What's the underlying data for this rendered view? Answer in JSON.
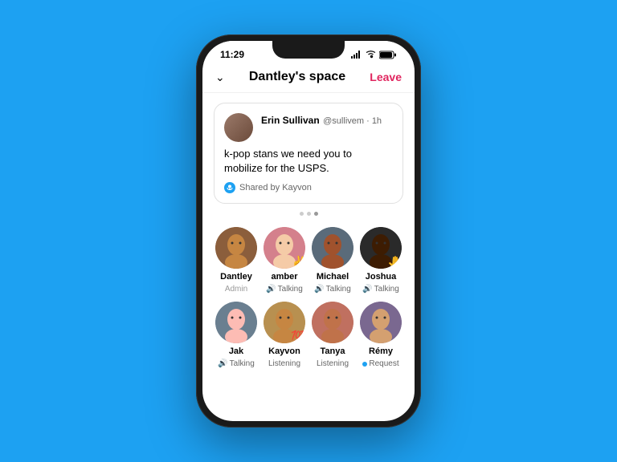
{
  "background": "#1DA1F2",
  "phone": {
    "status_bar": {
      "time": "11:29"
    },
    "header": {
      "title": "Dantley's space",
      "leave_label": "Leave",
      "chevron": "⌄"
    },
    "tweet_card": {
      "author_name": "Erin Sullivan",
      "author_handle": "@sullivem · 1h",
      "tweet_text": "k-pop stans we need you to mobilize for the USPS.",
      "shared_by": "Shared by Kayvon"
    },
    "dots": [
      {
        "active": false
      },
      {
        "active": false
      },
      {
        "active": true
      }
    ],
    "speakers": [
      {
        "name": "Dantley",
        "status": "Admin",
        "status_type": "admin",
        "emoji": "",
        "avatar_class": "av-dantley",
        "face": "👨🏽"
      },
      {
        "name": "amber",
        "status": "Talking",
        "status_type": "talking",
        "emoji": "✌️",
        "avatar_class": "av-amber",
        "face": "👩"
      },
      {
        "name": "Michael",
        "status": "Talking",
        "status_type": "talking",
        "emoji": "",
        "avatar_class": "av-michael",
        "face": "👨"
      },
      {
        "name": "Joshua",
        "status": "Talking",
        "status_type": "talking",
        "emoji": "🤚",
        "avatar_class": "av-joshua",
        "face": "🧑🏿"
      },
      {
        "name": "Jak",
        "status": "Talking",
        "status_type": "talking",
        "emoji": "",
        "avatar_class": "av-jak",
        "face": "👨🏼"
      },
      {
        "name": "Kayvon",
        "status": "Listening",
        "status_type": "listening",
        "emoji": "💯",
        "avatar_class": "av-kayvon",
        "face": "👨🏽"
      },
      {
        "name": "Tanya",
        "status": "Listening",
        "status_type": "listening",
        "emoji": "",
        "avatar_class": "av-tanya",
        "face": "👩🏽"
      },
      {
        "name": "Rémy",
        "status": "Request",
        "status_type": "request",
        "emoji": "",
        "avatar_class": "av-remy",
        "face": "🧑"
      }
    ]
  }
}
